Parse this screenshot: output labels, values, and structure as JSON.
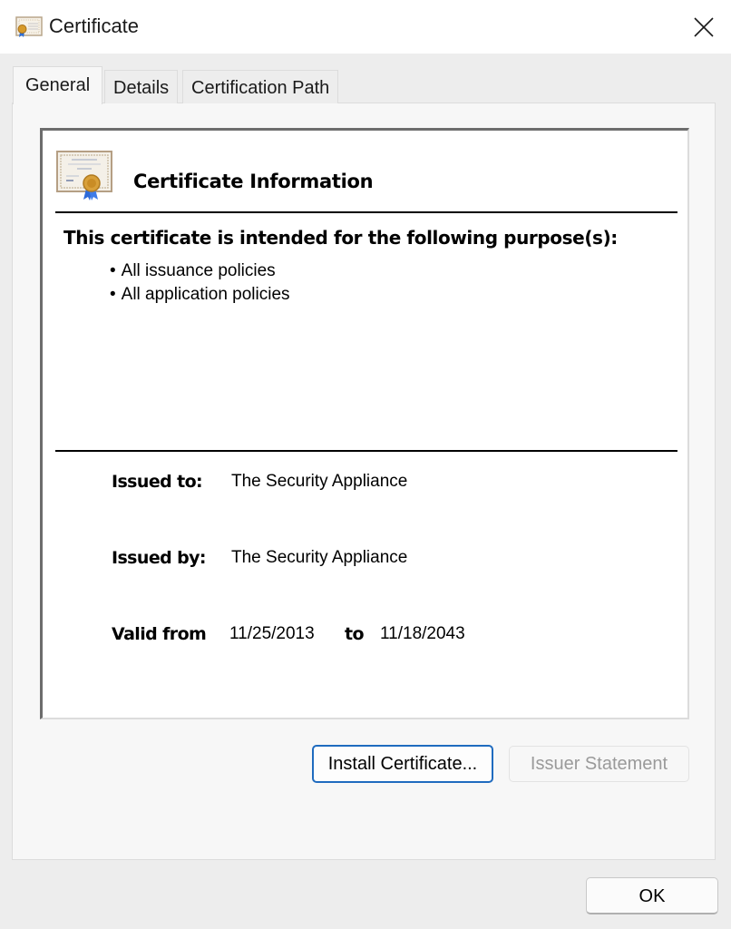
{
  "window": {
    "title": "Certificate",
    "icon": "certificate-icon",
    "close_icon": "close-icon"
  },
  "tabs": [
    {
      "label": "General",
      "active": true
    },
    {
      "label": "Details",
      "active": false
    },
    {
      "label": "Certification Path",
      "active": false
    }
  ],
  "general": {
    "info_title": "Certificate Information",
    "purpose_heading": "This certificate is intended for the following purpose(s):",
    "purposes": [
      "All issuance policies",
      "All application policies"
    ],
    "issued_to_label": "Issued to:",
    "issued_to_value": "The Security Appliance",
    "issued_by_label": "Issued by:",
    "issued_by_value": "The Security Appliance",
    "valid_from_label": "Valid from",
    "valid_from_value": "11/25/2013",
    "valid_to_label": "to",
    "valid_to_value": "11/18/2043"
  },
  "buttons": {
    "install_certificate": "Install Certificate...",
    "issuer_statement": "Issuer Statement",
    "ok": "OK"
  },
  "colors": {
    "focus_border": "#1f6bbf",
    "disabled_text": "#9a9a9a"
  }
}
